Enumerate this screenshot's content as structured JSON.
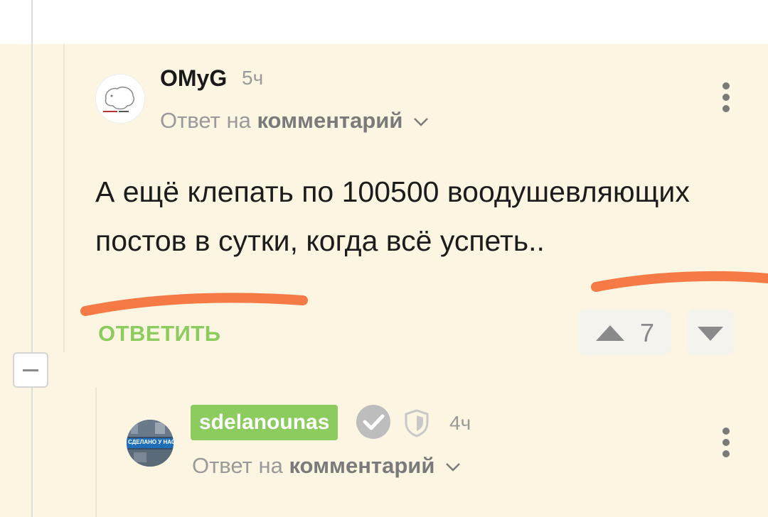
{
  "comment1": {
    "username": "OMyG",
    "time": "5ч",
    "reply_to_prefix": "Ответ на",
    "reply_to_target": "комментарий",
    "text": "А ещё клепать по 100500 воодушевляющих постов в сутки, когда всё успеть..",
    "reply_label": "ОТВЕТИТЬ",
    "rating": "7"
  },
  "comment2": {
    "username": "sdelanounas",
    "time": "4ч",
    "reply_to_prefix": "Ответ на",
    "reply_to_target": "комментарий",
    "avatar_text": "СДЕЛАНО У НАС"
  },
  "colors": {
    "thread_background": "#fbf5e2",
    "accent_green": "#8ccb5e",
    "marker_orange": "#f57a45",
    "muted_gray": "#9a9a9a"
  }
}
